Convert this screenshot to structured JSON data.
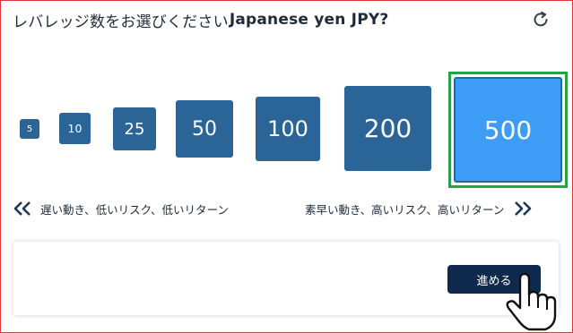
{
  "header": {
    "title_prefix": "レバレッジ数をお選びください",
    "title_currency": "Japanese yen JPY?"
  },
  "leverage": {
    "options": [
      "5",
      "10",
      "25",
      "50",
      "100",
      "200",
      "500"
    ],
    "selected": "500"
  },
  "speed": {
    "slow_label": "遅い動き、低いリスク、低いリターン",
    "fast_label": "素早い動き、高いリスク、高いリターン"
  },
  "panel": {
    "proceed_label": "進める"
  },
  "colors": {
    "tile": "#2b6597",
    "tile_selected": "#3d9cf6",
    "selection_ring": "#22a347",
    "button": "#102a4e",
    "frame_border": "#e0353b"
  },
  "icons": [
    "refresh-icon",
    "double-chevron-left-icon",
    "double-chevron-right-icon",
    "pointer-hand-icon"
  ]
}
